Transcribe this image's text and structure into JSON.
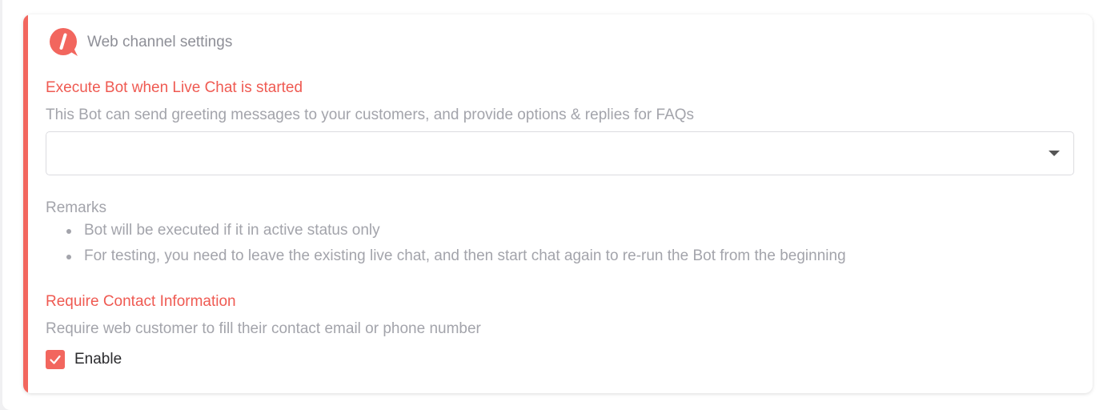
{
  "header": {
    "title": "Web channel settings",
    "logo_icon": "chat-bubble-slash-logo"
  },
  "bot_section": {
    "title": "Execute Bot when Live Chat is started",
    "description": "This Bot can send greeting messages to your customers, and provide options & replies for FAQs",
    "select": {
      "value": "",
      "icon": "chevron-down-icon"
    }
  },
  "remarks": {
    "title": "Remarks",
    "items": [
      "Bot will be executed if it in active status only",
      "For testing, you need to leave the existing live chat, and then start chat again to re-run the Bot from the beginning"
    ]
  },
  "contact_section": {
    "title": "Require Contact Information",
    "description": "Require web customer to fill their contact email or phone number",
    "checkbox": {
      "label": "Enable",
      "checked": true
    }
  },
  "colors": {
    "accent": "#f2665e",
    "section_title": "#ef5a52",
    "muted_text": "#a3a4ab"
  }
}
